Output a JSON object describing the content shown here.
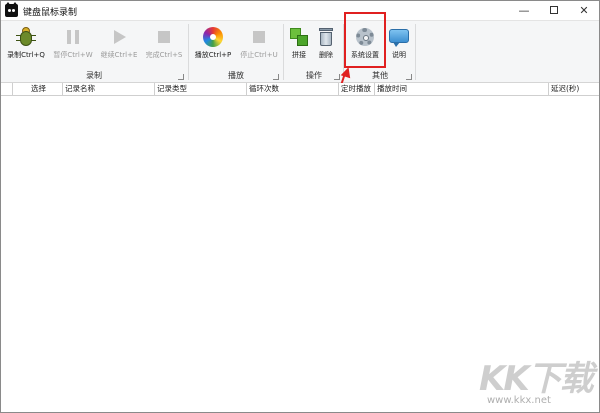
{
  "window": {
    "title": "键盘鼠标录制",
    "controls": {
      "minimize": "—",
      "close": "✕"
    }
  },
  "ribbon": {
    "groups": [
      {
        "label": "录制",
        "buttons": [
          {
            "label": "录制Ctrl+Q",
            "icon": "bug-icon",
            "enabled": true
          },
          {
            "label": "暂停Ctrl+W",
            "icon": "pause-icon",
            "enabled": false
          },
          {
            "label": "继续Ctrl+E",
            "icon": "play-icon",
            "enabled": false
          },
          {
            "label": "完成Ctrl+S",
            "icon": "stop-icon",
            "enabled": false
          }
        ]
      },
      {
        "label": "播放",
        "buttons": [
          {
            "label": "播放Ctrl+P",
            "icon": "color-disc-icon",
            "enabled": true
          },
          {
            "label": "停止Ctrl+U",
            "icon": "stop-icon",
            "enabled": false
          }
        ]
      },
      {
        "label": "操作",
        "buttons": [
          {
            "label": "拼接",
            "icon": "merge-icon",
            "enabled": true
          },
          {
            "label": "删除",
            "icon": "trash-icon",
            "enabled": true
          }
        ]
      },
      {
        "label": "其他",
        "buttons": [
          {
            "label": "系统设置",
            "icon": "gear-icon",
            "enabled": true
          },
          {
            "label": "说明",
            "icon": "help-bubble-icon",
            "enabled": true
          }
        ]
      }
    ]
  },
  "table": {
    "columns": [
      "选择",
      "记录名称",
      "记录类型",
      "循环次数",
      "定时播放",
      "播放时间",
      "延迟(秒)"
    ]
  },
  "watermark": {
    "logo": "KK下载",
    "url": "www.kkx.net"
  },
  "colors": {
    "highlight": "#e02020",
    "ribbon_bg": "#f5f6f7"
  }
}
